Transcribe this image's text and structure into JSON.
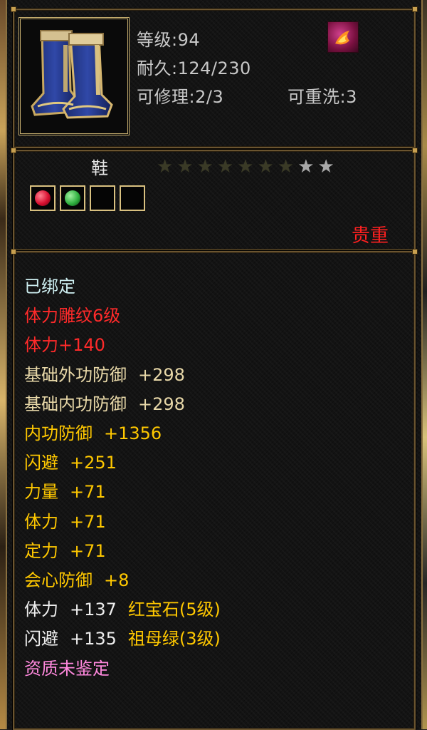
{
  "item": {
    "level": "等级:94",
    "durability": "耐久:124/230",
    "repairable": "可修理:2/3",
    "rewash": "可重洗:3",
    "type": "鞋",
    "quality": "贵重",
    "icon": "boots-icon",
    "special_icon": "flame-skill-icon",
    "stars": {
      "filled": 7,
      "total": 9,
      "filled_color": "#3a3a26",
      "empty_color": "#a8a8a8"
    },
    "sockets": [
      {
        "gem": "ruby",
        "color": "#d81030"
      },
      {
        "gem": "emerald",
        "color": "#30b040"
      },
      {
        "gem": "",
        "color": ""
      },
      {
        "gem": "",
        "color": ""
      }
    ]
  },
  "attributes": [
    {
      "text": "已绑定",
      "color": "cyan"
    },
    {
      "text": "体力雕纹6级",
      "color": "red"
    },
    {
      "text": "体力+140",
      "color": "red"
    },
    {
      "label": "基础外功防御",
      "value": "+298",
      "color": "cream"
    },
    {
      "label": "基础内功防御",
      "value": "+298",
      "color": "cream"
    },
    {
      "label": "内功防御",
      "value": "+1356",
      "color": "yellow"
    },
    {
      "label": "闪避",
      "value": "+251",
      "color": "yellow"
    },
    {
      "label": "力量",
      "value": "+71",
      "color": "yellow"
    },
    {
      "label": "体力",
      "value": "+71",
      "color": "yellow"
    },
    {
      "label": "定力",
      "value": "+71",
      "color": "yellow"
    },
    {
      "label": "会心防御",
      "value": "+8",
      "color": "yellow"
    },
    {
      "label": "体力",
      "value": "+137",
      "gem": "红宝石(5级)",
      "color": "white"
    },
    {
      "label": "闪避",
      "value": "+135",
      "gem": "祖母绿(3级)",
      "color": "white"
    },
    {
      "text": "资质未鉴定",
      "color": "pink"
    }
  ]
}
